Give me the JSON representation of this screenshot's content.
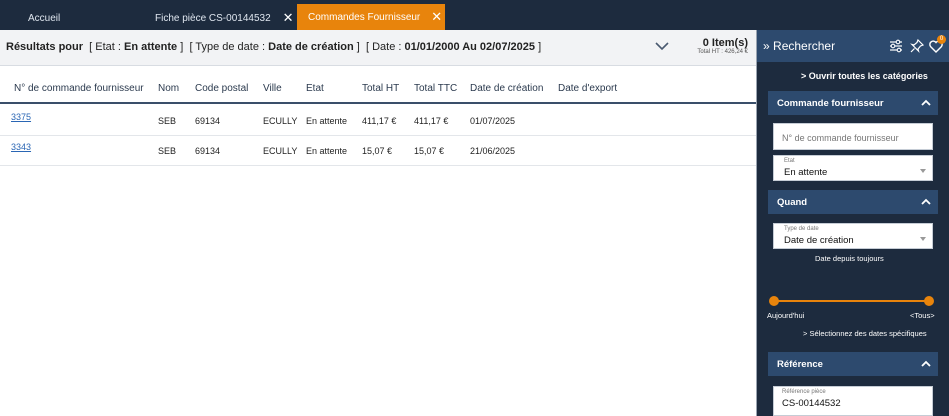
{
  "tabs": [
    {
      "label": "Accueil"
    },
    {
      "label": "Fiche pièce CS-00144532",
      "close": "✕"
    },
    {
      "label": "Commandes Fournisseur",
      "close": "✕"
    }
  ],
  "summary": {
    "prefix": "Résultats pour",
    "etat_label": "[ Etat :",
    "etat_value": "En attente",
    "etat_end": "]",
    "type_label": "[ Type de date :",
    "type_value": "Date de création",
    "type_end": "]",
    "date_label": "[ Date :",
    "date_value": "01/01/2000 Au 02/07/2025",
    "date_end": "]",
    "items": "0 Item(s)",
    "total": "Total HT : 426,24 €"
  },
  "table": {
    "headers": [
      "N° de commande fournisseur",
      "Nom",
      "Code postal",
      "Ville",
      "Etat",
      "Total HT",
      "Total TTC",
      "Date de création",
      "Date d'export"
    ],
    "rows": [
      [
        "3375",
        "SEB",
        "69134",
        "ECULLY",
        "En attente",
        "411,17 €",
        "411,17 €",
        "01/07/2025",
        ""
      ],
      [
        "3343",
        "SEB",
        "69134",
        "ECULLY",
        "En attente",
        "15,07 €",
        "15,07 €",
        "21/06/2025",
        ""
      ]
    ]
  },
  "panel": {
    "title": "Rechercher",
    "badge": "0",
    "open_all": "Ouvrir toutes les catégories",
    "section_commande": "Commande fournisseur",
    "order_placeholder": "N° de commande fournisseur",
    "etat_caption": "Etat",
    "etat_value": "En attente",
    "section_quand": "Quand",
    "type_caption": "Type de date",
    "type_value": "Date de création",
    "date_since": "Date depuis toujours",
    "today": "Aujourd'hui",
    "all": "<Tous>",
    "specific_dates": "Sélectionnez des dates spécifiques",
    "section_reference": "Référence",
    "ref_caption": "Référence pièce",
    "ref_value": "CS-00144532",
    "slider_range": [
      0,
      1
    ]
  },
  "colors": {
    "accent": "#e8840c",
    "dark": "#1d2b3e",
    "section": "#2d4a6e",
    "link": "#2a66b4"
  }
}
